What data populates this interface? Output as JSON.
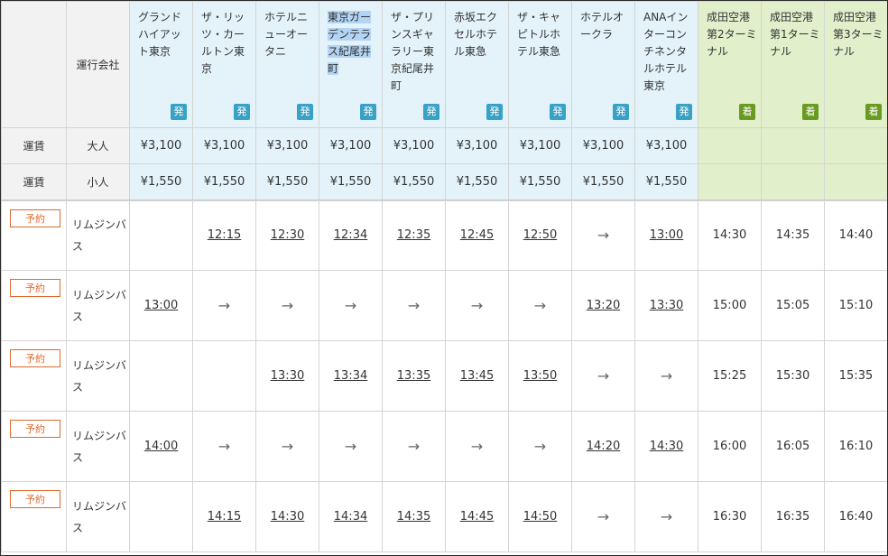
{
  "header": {
    "operator_label": "運行会社",
    "stops": [
      {
        "name": "グランドハイアット東京",
        "badge": "発",
        "kind": "dep"
      },
      {
        "name": "ザ・リッツ・カールトン東京",
        "badge": "発",
        "kind": "dep"
      },
      {
        "name": "ホテルニューオータニ",
        "badge": "発",
        "kind": "dep"
      },
      {
        "name": "東京ガーデンテラス紀尾井町",
        "badge": "発",
        "kind": "dep",
        "highlighted": true
      },
      {
        "name": "ザ・プリンスギャラリー東京紀尾井町",
        "badge": "発",
        "kind": "dep"
      },
      {
        "name": "赤坂エクセルホテル東急",
        "badge": "発",
        "kind": "dep"
      },
      {
        "name": "ザ・キャピトルホテル東急",
        "badge": "発",
        "kind": "dep"
      },
      {
        "name": "ホテルオークラ",
        "badge": "発",
        "kind": "dep"
      },
      {
        "name": "ANAインターコンチネンタルホテル東京",
        "badge": "発",
        "kind": "dep"
      },
      {
        "name": "成田空港第2ターミナル",
        "badge": "着",
        "kind": "arr"
      },
      {
        "name": "成田空港第1ターミナル",
        "badge": "着",
        "kind": "arr"
      },
      {
        "name": "成田空港第3ターミナル",
        "badge": "着",
        "kind": "arr"
      }
    ]
  },
  "fares": [
    {
      "label": "運賃",
      "type": "大人",
      "values": [
        "¥3,100",
        "¥3,100",
        "¥3,100",
        "¥3,100",
        "¥3,100",
        "¥3,100",
        "¥3,100",
        "¥3,100",
        "¥3,100",
        "",
        "",
        ""
      ]
    },
    {
      "label": "運賃",
      "type": "小人",
      "values": [
        "¥1,550",
        "¥1,550",
        "¥1,550",
        "¥1,550",
        "¥1,550",
        "¥1,550",
        "¥1,550",
        "¥1,550",
        "¥1,550",
        "",
        "",
        ""
      ]
    }
  ],
  "trips": [
    {
      "reserve_label": "予約",
      "operator": "リムジンバス",
      "cells": [
        "",
        "12:15",
        "12:30",
        "12:34",
        "12:35",
        "12:45",
        "12:50",
        "→",
        "13:00",
        "14:30",
        "14:35",
        "14:40"
      ]
    },
    {
      "reserve_label": "予約",
      "operator": "リムジンバス",
      "cells": [
        "13:00",
        "→",
        "→",
        "→",
        "→",
        "→",
        "→",
        "13:20",
        "13:30",
        "15:00",
        "15:05",
        "15:10"
      ]
    },
    {
      "reserve_label": "予約",
      "operator": "リムジンバス",
      "cells": [
        "",
        "",
        "13:30",
        "13:34",
        "13:35",
        "13:45",
        "13:50",
        "→",
        "→",
        "15:25",
        "15:30",
        "15:35"
      ]
    },
    {
      "reserve_label": "予約",
      "operator": "リムジンバス",
      "cells": [
        "14:00",
        "→",
        "→",
        "→",
        "→",
        "→",
        "→",
        "14:20",
        "14:30",
        "16:00",
        "16:05",
        "16:10"
      ]
    },
    {
      "reserve_label": "予約",
      "operator": "リムジンバス",
      "cells": [
        "",
        "14:15",
        "14:30",
        "14:34",
        "14:35",
        "14:45",
        "14:50",
        "→",
        "→",
        "16:30",
        "16:35",
        "16:40"
      ]
    }
  ],
  "colors": {
    "departure_bg": "#e4f3f9",
    "arrival_bg": "#e2efcb",
    "departure_badge": "#38a2c6",
    "arrival_badge": "#6a9a21",
    "reserve_accent": "#e2682a"
  }
}
